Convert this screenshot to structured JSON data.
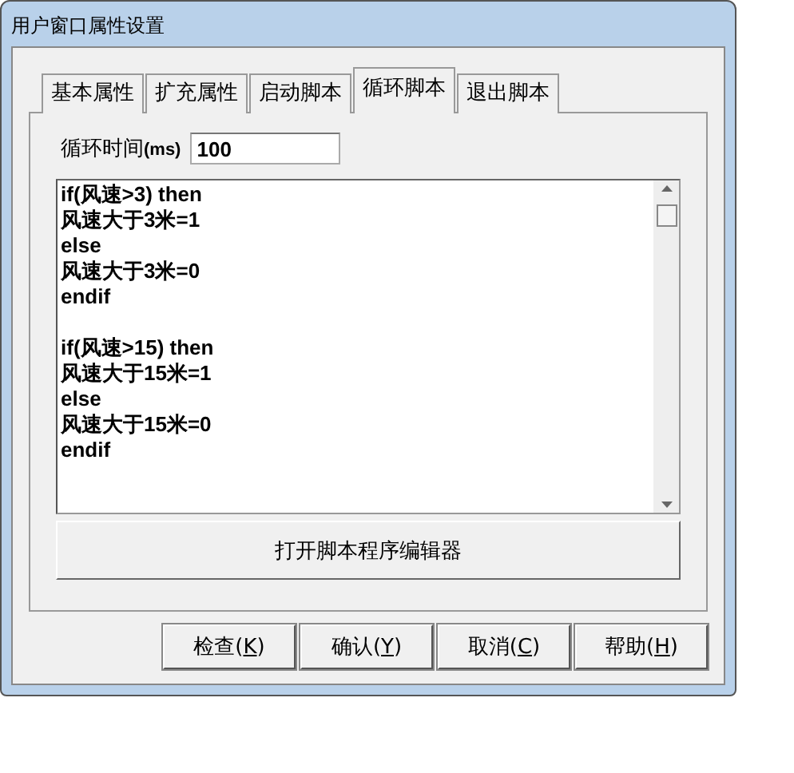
{
  "window": {
    "title": "用户窗口属性设置"
  },
  "tabs": [
    {
      "label": "基本属性",
      "selected": false
    },
    {
      "label": "扩充属性",
      "selected": false
    },
    {
      "label": "启动脚本",
      "selected": false
    },
    {
      "label": "循环脚本",
      "selected": true
    },
    {
      "label": "退出脚本",
      "selected": false
    }
  ],
  "interval": {
    "label": "循环时间",
    "unit": "(ms)",
    "value": "100"
  },
  "script_blocks": [
    [
      "if(风速>3) then",
      "风速大于3米=1",
      "else",
      "风速大于3米=0",
      "endif"
    ],
    [
      "if(风速>15) then",
      "风速大于15米=1",
      "else",
      "风速大于15米=0",
      "endif"
    ]
  ],
  "editor_button": "打开脚本程序编辑器",
  "buttons": [
    {
      "before": "检查(",
      "key": "K",
      "after": ")"
    },
    {
      "before": "确认(",
      "key": "Y",
      "after": ")"
    },
    {
      "before": "取消(",
      "key": "C",
      "after": ")"
    },
    {
      "before": "帮助(",
      "key": "H",
      "after": ")"
    }
  ]
}
